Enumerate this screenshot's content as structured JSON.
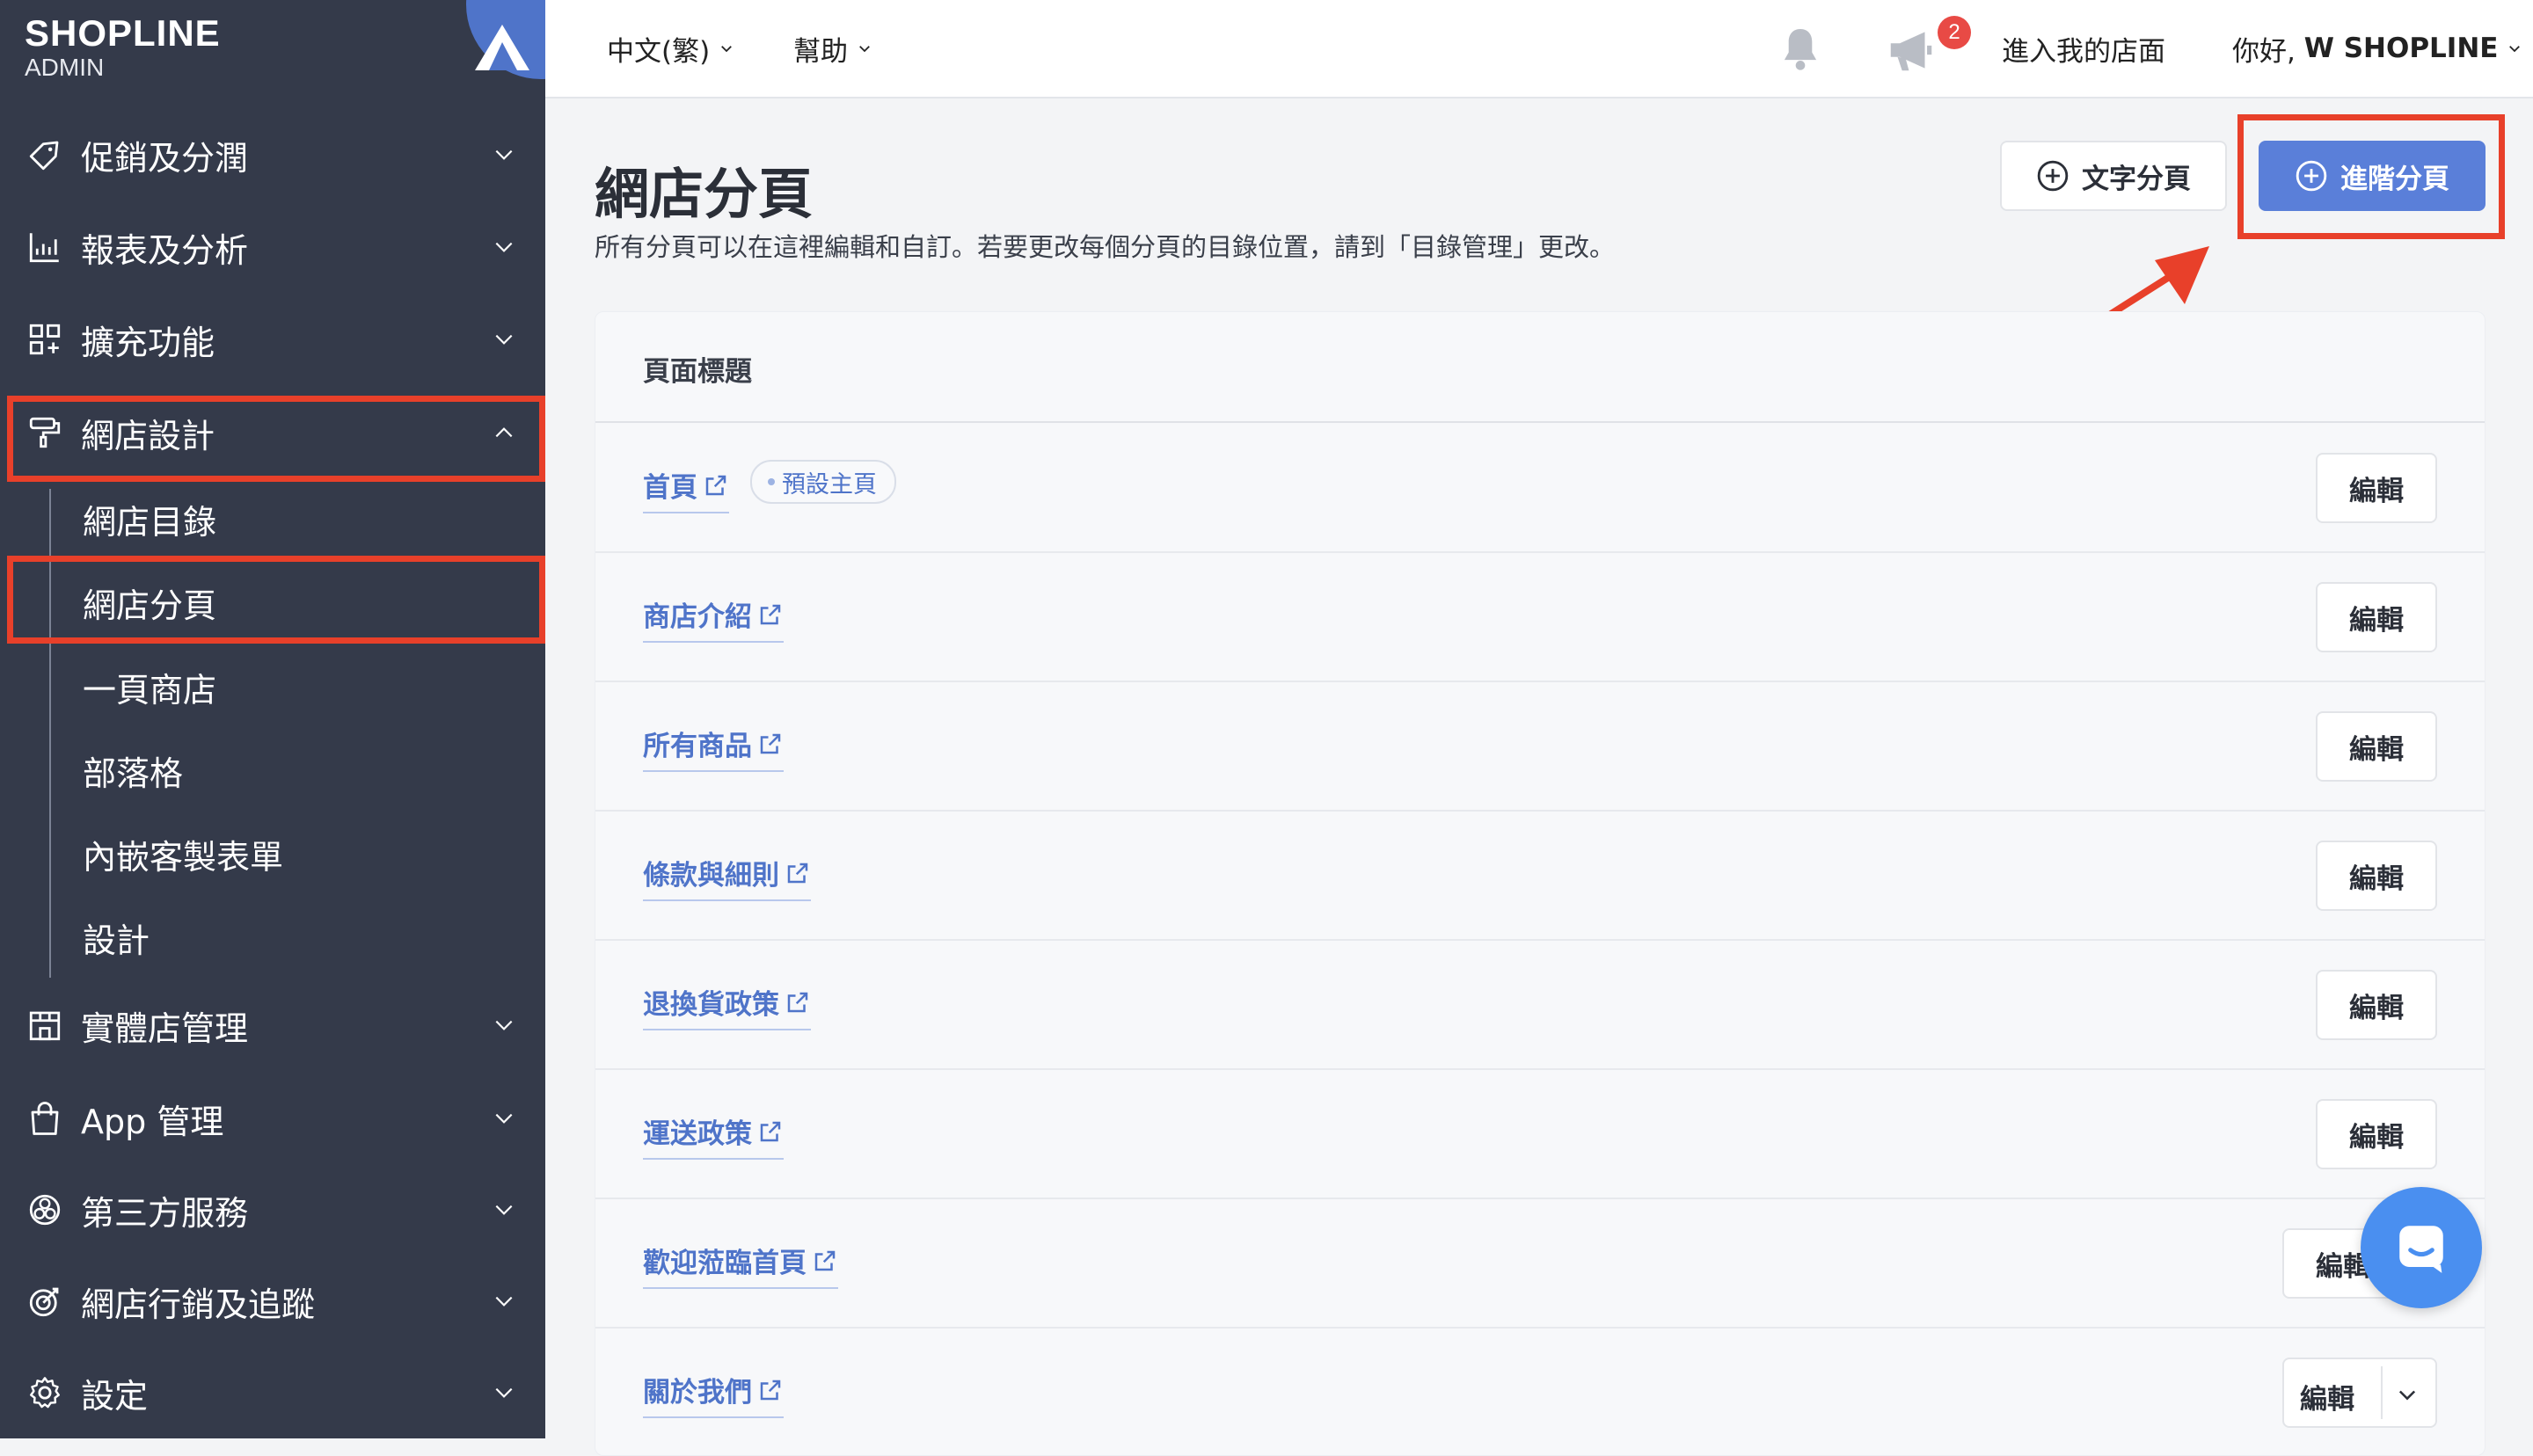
{
  "brand": {
    "name": "SHOPLINE",
    "sub": "ADMIN"
  },
  "sidebar": {
    "items": [
      {
        "label": "促銷及分潤",
        "icon": "tag-icon"
      },
      {
        "label": "報表及分析",
        "icon": "chart-icon"
      },
      {
        "label": "擴充功能",
        "icon": "extension-icon"
      },
      {
        "label": "網店設計",
        "icon": "paint-roller-icon",
        "expanded": true
      },
      {
        "label": "實體店管理",
        "icon": "store-icon"
      },
      {
        "label": "App 管理",
        "icon": "shopping-bag-icon"
      },
      {
        "label": "第三方服務",
        "icon": "third-party-icon"
      },
      {
        "label": "網店行銷及追蹤",
        "icon": "target-icon"
      },
      {
        "label": "設定",
        "icon": "gear-icon"
      }
    ],
    "subitems": [
      "網店目錄",
      "網店分頁",
      "一頁商店",
      "部落格",
      "內嵌客製表單",
      "設計"
    ]
  },
  "topbar": {
    "language": "中文(繁)",
    "help": "幫助",
    "notification_count": "2",
    "visit_store": "進入我的店面",
    "greeting_prefix": "你好, ",
    "greeting_name": "W SHOPLINE"
  },
  "main": {
    "title": "網店分頁",
    "description": "所有分頁可以在這裡編輯和自訂。若要更改每個分頁的目錄位置，請到「目錄管理」更改。",
    "btn_text_page": "文字分頁",
    "btn_advanced_page": "進階分頁",
    "table_header": "頁面標題",
    "rows": [
      {
        "title": "首頁",
        "tag": "預設主頁",
        "action": "編輯"
      },
      {
        "title": "商店介紹",
        "action": "編輯"
      },
      {
        "title": "所有商品",
        "action": "編輯"
      },
      {
        "title": "條款與細則",
        "action": "編輯"
      },
      {
        "title": "退換貨政策",
        "action": "編輯"
      },
      {
        "title": "運送政策",
        "action": "編輯"
      },
      {
        "title": "歡迎蒞臨首頁",
        "action": "編輯"
      },
      {
        "title": "關於我們",
        "action": "編輯"
      }
    ]
  },
  "colors": {
    "sidebar_bg": "#343a4a",
    "accent_blue": "#5a7fd9",
    "link_blue": "#4f74c9",
    "highlight_red": "#e8402a",
    "badge_red": "#e84a45"
  }
}
